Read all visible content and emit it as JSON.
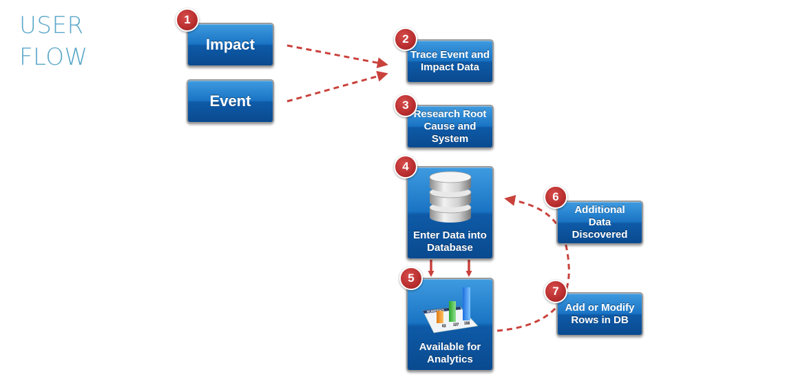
{
  "title": {
    "line1": "USER",
    "line2": "FLOW"
  },
  "steps": [
    {
      "number": "1",
      "label": "Impact"
    },
    {
      "label": "Event"
    },
    {
      "number": "2",
      "label": "Trace Event and Impact Data"
    },
    {
      "number": "3",
      "label": "Research Root Cause and System"
    },
    {
      "number": "4",
      "label": "Enter Data into Database",
      "icon": "database-icon"
    },
    {
      "number": "5",
      "label": "Available for Analytics",
      "icon": "bar-chart-icon"
    },
    {
      "number": "6",
      "label": "Additional Data Discovered"
    },
    {
      "number": "7",
      "label": "Add or Modify Rows in DB"
    }
  ],
  "chart_icon": {
    "header": "NUMBERS",
    "values": [
      "63",
      "127",
      "156"
    ]
  },
  "colors": {
    "box": "#1a74c4",
    "badge": "#b82e2e",
    "arrow": "#c9413b",
    "title": "#5aa7c9"
  }
}
